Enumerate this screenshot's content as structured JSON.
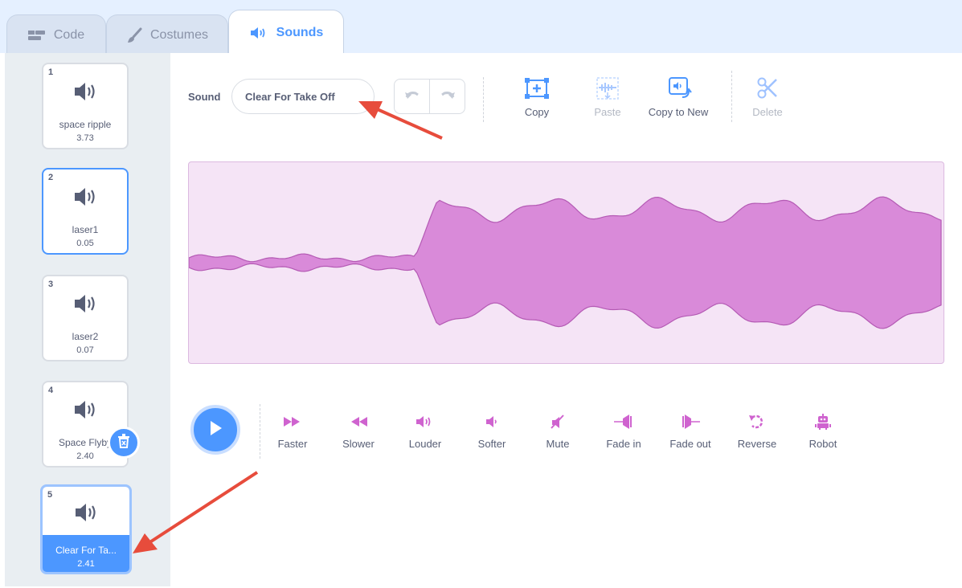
{
  "tabs": [
    {
      "label": "Code",
      "icon": "code-icon"
    },
    {
      "label": "Costumes",
      "icon": "brush-icon"
    },
    {
      "label": "Sounds",
      "icon": "speaker-icon",
      "active": true
    }
  ],
  "sounds": [
    {
      "number": "1",
      "name": "space ripple",
      "duration": "3.73"
    },
    {
      "number": "2",
      "name": "laser1",
      "duration": "0.05"
    },
    {
      "number": "3",
      "name": "laser2",
      "duration": "0.07"
    },
    {
      "number": "4",
      "name": "Space Flyby",
      "duration": "2.40"
    },
    {
      "number": "5",
      "name": "Clear For Ta...",
      "duration": "2.41",
      "selected": true
    }
  ],
  "editor": {
    "sound_label": "Sound",
    "sound_name": "Clear For Take Off",
    "tools": {
      "copy": "Copy",
      "paste": "Paste",
      "copy_to_new": "Copy to New",
      "delete": "Delete"
    },
    "effects": [
      "Faster",
      "Slower",
      "Louder",
      "Softer",
      "Mute",
      "Fade in",
      "Fade out",
      "Reverse",
      "Robot"
    ]
  },
  "colors": {
    "accent": "#4c97ff",
    "waveform": "#d98ad9",
    "waveform_bg": "#f5e4f6",
    "effect_icon": "#cf63cf",
    "arrow": "#e74c3c"
  }
}
